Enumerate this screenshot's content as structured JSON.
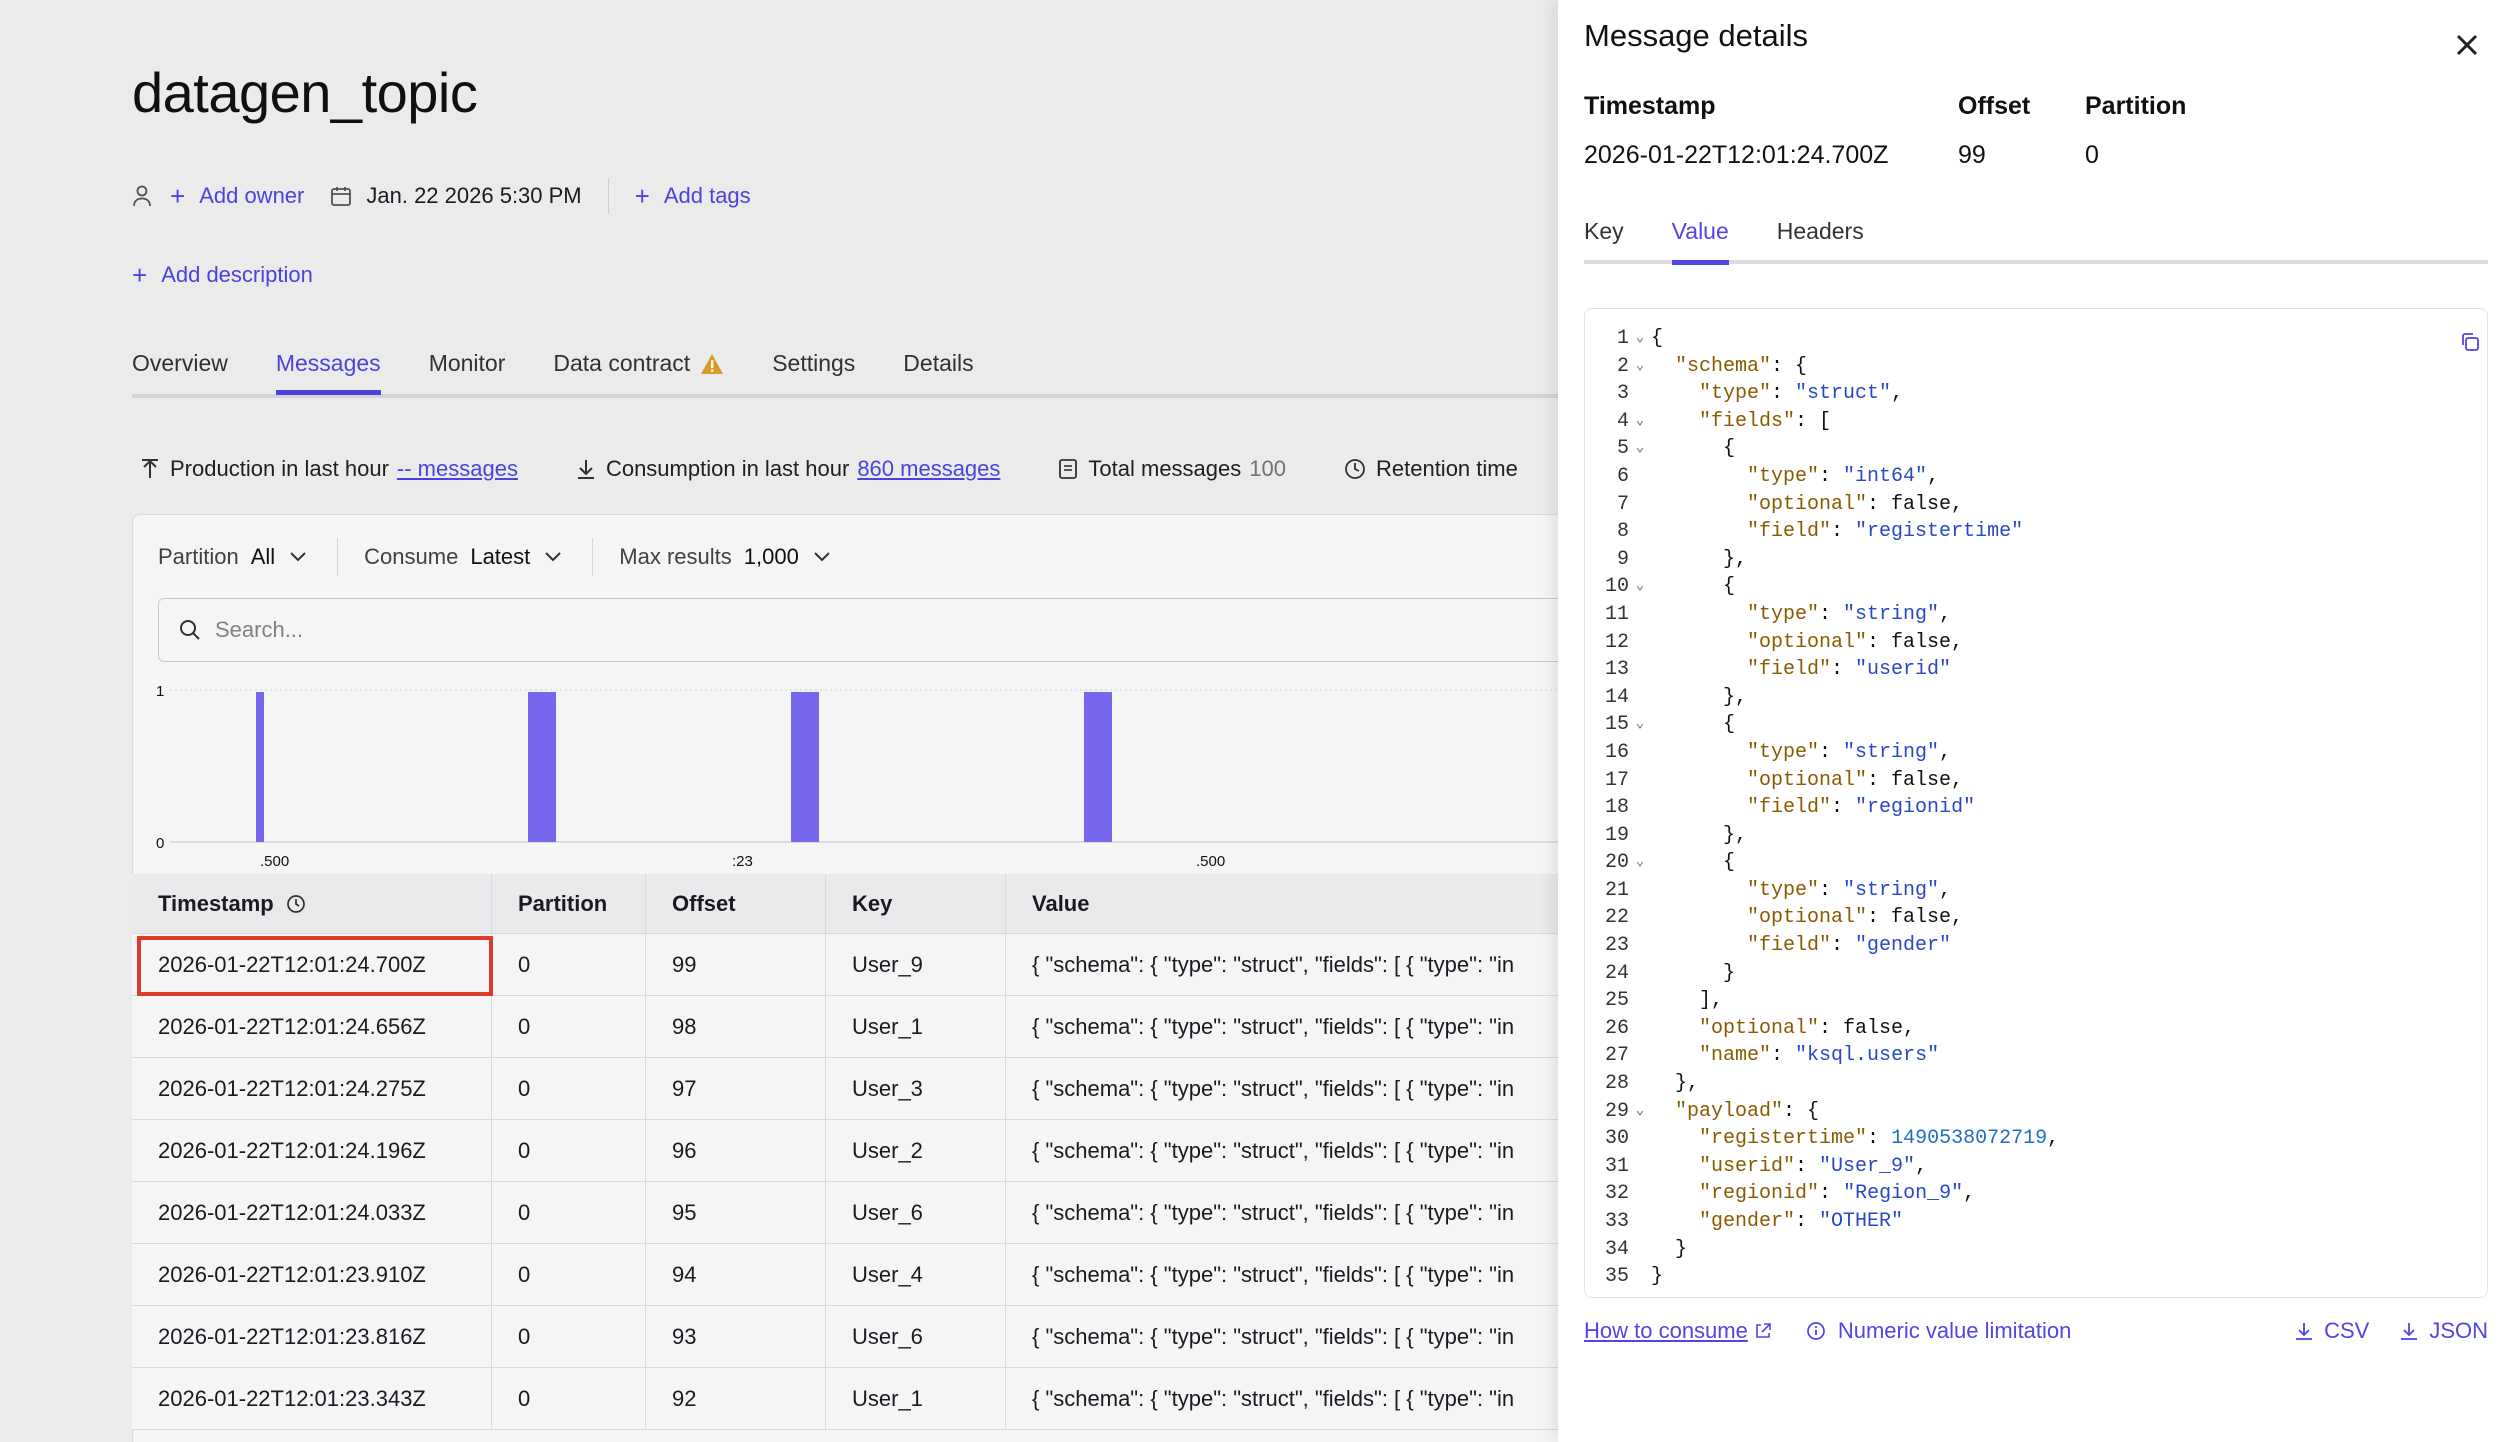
{
  "topic": {
    "title": "datagen_topic"
  },
  "meta": {
    "add_owner": "Add owner",
    "date": "Jan. 22 2026 5:30 PM",
    "add_tags": "Add tags",
    "add_description": "Add description"
  },
  "tabs": [
    {
      "label": "Overview"
    },
    {
      "label": "Messages",
      "active": true
    },
    {
      "label": "Monitor"
    },
    {
      "label": "Data contract",
      "warning": true
    },
    {
      "label": "Settings"
    },
    {
      "label": "Details"
    }
  ],
  "stats": {
    "production_label": "Production in last hour",
    "production_value": "-- messages",
    "consumption_label": "Consumption in last hour",
    "consumption_value": "860 messages",
    "total_label": "Total messages",
    "total_value": "100",
    "retention_label": "Retention time"
  },
  "filters": {
    "partition_label": "Partition",
    "partition_value": "All",
    "consume_label": "Consume",
    "consume_value": "Latest",
    "max_label": "Max results",
    "max_value": "1,000"
  },
  "search": {
    "placeholder": "Search..."
  },
  "chart_data": {
    "type": "bar",
    "y_ticks": [
      "1",
      "0"
    ],
    "x_ticks": [
      ".500",
      ":23",
      ".500"
    ],
    "ylim": [
      0,
      1
    ],
    "bars": [
      1,
      1,
      1,
      1
    ],
    "color": "#7b6cf6"
  },
  "table": {
    "columns": [
      "Timestamp",
      "Partition",
      "Offset",
      "Key",
      "Value"
    ],
    "rows": [
      {
        "timestamp": "2026-01-22T12:01:24.700Z",
        "partition": "0",
        "offset": "99",
        "key": "User_9",
        "value": "{ \"schema\": { \"type\": \"struct\", \"fields\": [ { \"type\": \"in"
      },
      {
        "timestamp": "2026-01-22T12:01:24.656Z",
        "partition": "0",
        "offset": "98",
        "key": "User_1",
        "value": "{ \"schema\": { \"type\": \"struct\", \"fields\": [ { \"type\": \"in"
      },
      {
        "timestamp": "2026-01-22T12:01:24.275Z",
        "partition": "0",
        "offset": "97",
        "key": "User_3",
        "value": "{ \"schema\": { \"type\": \"struct\", \"fields\": [ { \"type\": \"in"
      },
      {
        "timestamp": "2026-01-22T12:01:24.196Z",
        "partition": "0",
        "offset": "96",
        "key": "User_2",
        "value": "{ \"schema\": { \"type\": \"struct\", \"fields\": [ { \"type\": \"in"
      },
      {
        "timestamp": "2026-01-22T12:01:24.033Z",
        "partition": "0",
        "offset": "95",
        "key": "User_6",
        "value": "{ \"schema\": { \"type\": \"struct\", \"fields\": [ { \"type\": \"in"
      },
      {
        "timestamp": "2026-01-22T12:01:23.910Z",
        "partition": "0",
        "offset": "94",
        "key": "User_4",
        "value": "{ \"schema\": { \"type\": \"struct\", \"fields\": [ { \"type\": \"in"
      },
      {
        "timestamp": "2026-01-22T12:01:23.816Z",
        "partition": "0",
        "offset": "93",
        "key": "User_6",
        "value": "{ \"schema\": { \"type\": \"struct\", \"fields\": [ { \"type\": \"in"
      },
      {
        "timestamp": "2026-01-22T12:01:23.343Z",
        "partition": "0",
        "offset": "92",
        "key": "User_1",
        "value": "{ \"schema\": { \"type\": \"struct\", \"fields\": [ { \"type\": \"in"
      }
    ]
  },
  "drawer": {
    "title": "Message details",
    "timestamp_label": "Timestamp",
    "timestamp_value": "2026-01-22T12:01:24.700Z",
    "offset_label": "Offset",
    "offset_value": "99",
    "partition_label": "Partition",
    "partition_value": "0",
    "tabs": [
      {
        "label": "Key"
      },
      {
        "label": "Value",
        "active": true
      },
      {
        "label": "Headers"
      }
    ],
    "code_lines": [
      {
        "n": "1",
        "fold": true,
        "t": "{"
      },
      {
        "n": "2",
        "fold": true,
        "t": "  \"schema\": {"
      },
      {
        "n": "3",
        "fold": false,
        "t": "    \"type\": \"struct\","
      },
      {
        "n": "4",
        "fold": true,
        "t": "    \"fields\": ["
      },
      {
        "n": "5",
        "fold": true,
        "t": "      {"
      },
      {
        "n": "6",
        "fold": false,
        "t": "        \"type\": \"int64\","
      },
      {
        "n": "7",
        "fold": false,
        "t": "        \"optional\": false,"
      },
      {
        "n": "8",
        "fold": false,
        "t": "        \"field\": \"registertime\""
      },
      {
        "n": "9",
        "fold": false,
        "t": "      },"
      },
      {
        "n": "10",
        "fold": true,
        "t": "      {"
      },
      {
        "n": "11",
        "fold": false,
        "t": "        \"type\": \"string\","
      },
      {
        "n": "12",
        "fold": false,
        "t": "        \"optional\": false,"
      },
      {
        "n": "13",
        "fold": false,
        "t": "        \"field\": \"userid\""
      },
      {
        "n": "14",
        "fold": false,
        "t": "      },"
      },
      {
        "n": "15",
        "fold": true,
        "t": "      {"
      },
      {
        "n": "16",
        "fold": false,
        "t": "        \"type\": \"string\","
      },
      {
        "n": "17",
        "fold": false,
        "t": "        \"optional\": false,"
      },
      {
        "n": "18",
        "fold": false,
        "t": "        \"field\": \"regionid\""
      },
      {
        "n": "19",
        "fold": false,
        "t": "      },"
      },
      {
        "n": "20",
        "fold": true,
        "t": "      {"
      },
      {
        "n": "21",
        "fold": false,
        "t": "        \"type\": \"string\","
      },
      {
        "n": "22",
        "fold": false,
        "t": "        \"optional\": false,"
      },
      {
        "n": "23",
        "fold": false,
        "t": "        \"field\": \"gender\""
      },
      {
        "n": "24",
        "fold": false,
        "t": "      }"
      },
      {
        "n": "25",
        "fold": false,
        "t": "    ],"
      },
      {
        "n": "26",
        "fold": false,
        "t": "    \"optional\": false,"
      },
      {
        "n": "27",
        "fold": false,
        "t": "    \"name\": \"ksql.users\""
      },
      {
        "n": "28",
        "fold": false,
        "t": "  },"
      },
      {
        "n": "29",
        "fold": true,
        "t": "  \"payload\": {"
      },
      {
        "n": "30",
        "fold": false,
        "t": "    \"registertime\": 1490538072719,"
      },
      {
        "n": "31",
        "fold": false,
        "t": "    \"userid\": \"User_9\","
      },
      {
        "n": "32",
        "fold": false,
        "t": "    \"regionid\": \"Region_9\","
      },
      {
        "n": "33",
        "fold": false,
        "t": "    \"gender\": \"OTHER\""
      },
      {
        "n": "34",
        "fold": false,
        "t": "  }"
      },
      {
        "n": "35",
        "fold": false,
        "t": "}"
      }
    ],
    "footer": {
      "how_to": "How to consume",
      "numeric": "Numeric value limitation",
      "csv": "CSV",
      "json": "JSON"
    }
  }
}
